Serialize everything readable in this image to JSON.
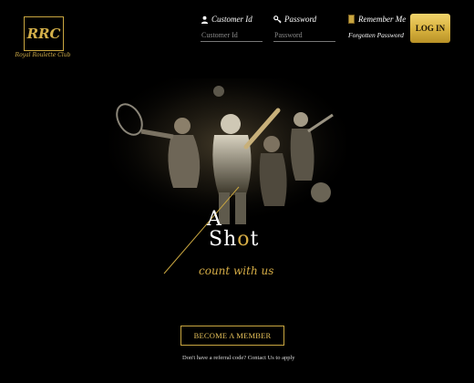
{
  "brand": {
    "logo_text": "RRC",
    "tagline": "Royal Roulette Club"
  },
  "login": {
    "customer_id_label": "Customer Id",
    "customer_id_placeholder": "Customer Id",
    "password_label": "Password",
    "password_placeholder": "Password",
    "remember_label": "Remember Me",
    "forgot_label": "Forgotten Password",
    "login_button": "LOG IN"
  },
  "hero": {
    "word_a": "A",
    "word_shot_1": "Sh",
    "word_shot_2": "o",
    "word_shot_3": "t",
    "tagline": "count with us"
  },
  "cta": {
    "member_button": "BECOME A MEMBER",
    "referral_text": "Don't have a referral code? Contact Us to apply"
  },
  "colors": {
    "background": "#000000",
    "gold": "#d6ad46",
    "gold_button": "#d8b23e"
  },
  "icons": [
    "user-icon",
    "key-icon",
    "checkbox"
  ]
}
